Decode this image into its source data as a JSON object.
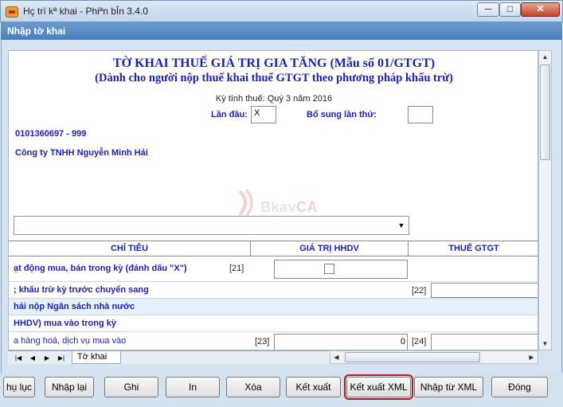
{
  "window": {
    "title": "Hç trï kª khai - Phiªn bÎn 3.4.0",
    "min": "─",
    "max": "□",
    "close": "✕"
  },
  "subtitle": "Nhập tờ khai",
  "form": {
    "title": "TỜ KHAI THUẾ GIÁ TRỊ GIA TĂNG (Mẫu số 01/GTGT)",
    "subtitle": "(Dành cho người nộp thuế khai thuế GTGT theo phương pháp khấu trừ)",
    "period": "Kỳ tính thuế: Quý 3 năm 2016",
    "first_time_label": "Lần đầu:",
    "first_time_value": "X",
    "supplement_label": "Bổ sung lần thứ:",
    "supplement_value": "",
    "tax_id": "0101360697  - 999",
    "company": "Công ty TNHH Nguyễn Minh Hải",
    "watermark": "Bkav",
    "watermark_ca": "CA"
  },
  "table": {
    "headers": [
      "CHỈ TIÊU",
      "GIÁ TRỊ HHDV",
      "THUẾ GTGT"
    ],
    "rows": [
      {
        "text": "ạt động mua, bán trong kỳ (đánh dấu \"X\")",
        "code": "[21]"
      },
      {
        "text": "; khấu trừ kỳ trước chuyển sang",
        "code": "[22]"
      },
      {
        "text": "hải nộp Ngân sách nhà nước"
      },
      {
        "text": "HHDV) mua vào trong kỳ"
      },
      {
        "text": "a hàng hoá, dịch vụ mua vào",
        "code": "[23]",
        "value": "0",
        "code2": "[24]"
      }
    ]
  },
  "sheet_tab": "Tờ khai",
  "buttons": {
    "phu_luc": "hụ lục",
    "nhap_lai": "Nhập lại",
    "ghi": "Ghi",
    "in": "In",
    "xoa": "Xóa",
    "ket_xuat": "Kết xuất",
    "ket_xuat_xml": "Kết xuất XML",
    "nhap_tu_xml": "Nhập từ XML",
    "dong": "Đóng"
  },
  "nav": {
    "first": "|◀",
    "prev": "◀",
    "next": "▶",
    "last": "▶|",
    "up": "▲",
    "down": "▼",
    "left": "◀",
    "right": "▶",
    "combo_arrow": "▼"
  }
}
